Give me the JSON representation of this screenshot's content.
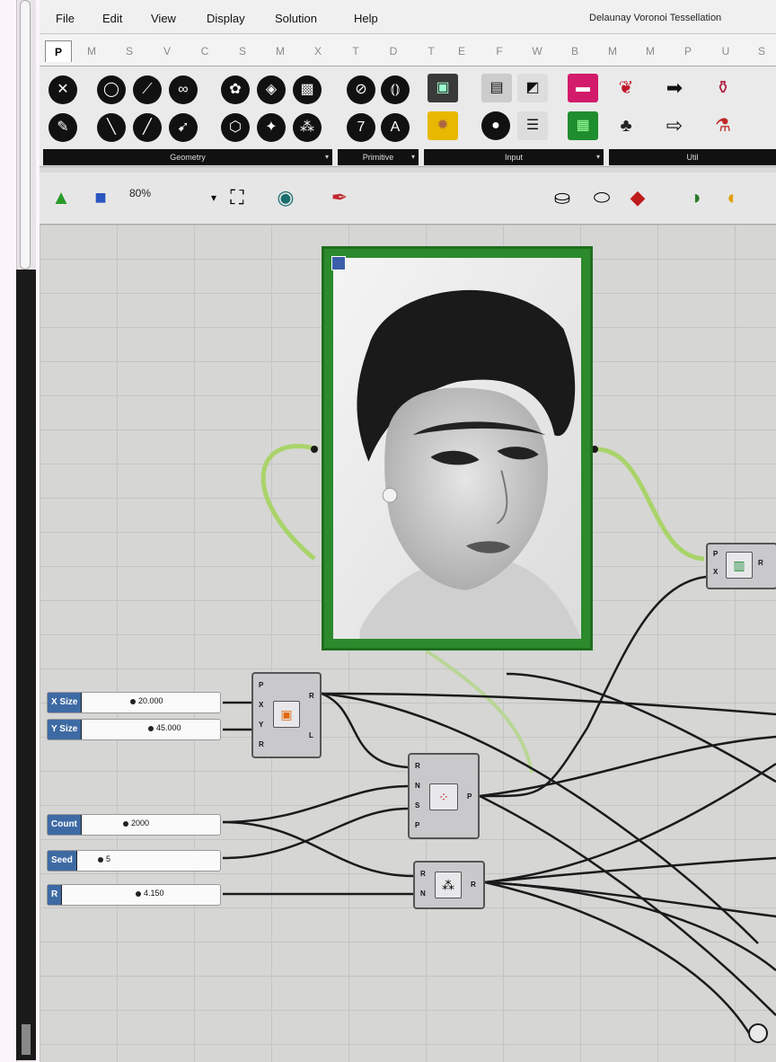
{
  "menu": [
    "File",
    "Edit",
    "View",
    "Display",
    "Solution",
    "Help"
  ],
  "document_title": "Delaunay Voronoi Tessellation",
  "tabs": [
    "P",
    "M",
    "S",
    "V",
    "C",
    "S",
    "M",
    "X",
    "T",
    "D",
    "T",
    "E",
    "F",
    "W",
    "B",
    "M",
    "M",
    "P",
    "U",
    "S"
  ],
  "ribbon_groups": {
    "geometry": "Geometry",
    "primitive": "Primitive",
    "input": "Input",
    "util": "Util"
  },
  "zoom_level": "80%",
  "canvas": {
    "sliders": {
      "x_size": {
        "label": "X Size",
        "value": "20.000"
      },
      "y_size": {
        "label": "Y Size",
        "value": "45.000"
      },
      "count": {
        "label": "Count",
        "value": "2000"
      },
      "seed": {
        "label": "Seed",
        "value": "5"
      },
      "r": {
        "label": "R",
        "value": "4.150"
      }
    },
    "rectangle_component": {
      "inputs": [
        "P",
        "X",
        "Y",
        "R"
      ],
      "outputs": [
        "R",
        "L"
      ]
    },
    "populate_component": {
      "inputs": [
        "R",
        "N",
        "S",
        "P"
      ],
      "outputs": [
        "P"
      ]
    },
    "range_component": {
      "inputs": [
        "R",
        "N"
      ],
      "outputs": [
        "R"
      ]
    },
    "image_sampler": {
      "inputs": [
        "P",
        "X"
      ],
      "outputs": [
        "R"
      ]
    }
  },
  "colors": {
    "slider_label_bg": "#3e6aa4",
    "image_frame": "#2c8a2c",
    "selected_wire": "#a9d46a",
    "wire": "#1a1a1a",
    "canvas": "#d6d6d4"
  }
}
